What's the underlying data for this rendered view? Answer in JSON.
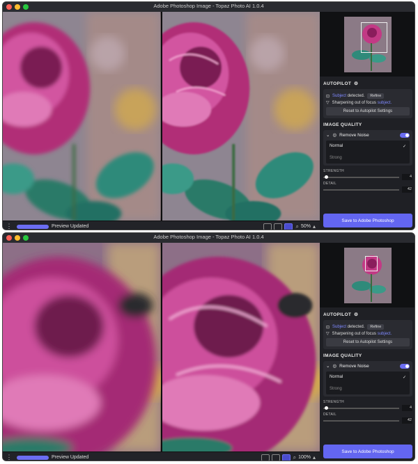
{
  "windows": [
    {
      "title": "Adobe Photoshop Image - Topaz Photo AI 1.0.4",
      "status": "Preview Updated",
      "zoom": "50%",
      "zoom_level": 0.5
    },
    {
      "title": "Adobe Photoshop Image - Topaz Photo AI 1.0.4",
      "status": "Preview Updated",
      "zoom": "100%",
      "zoom_level": 1.0
    }
  ],
  "panel": {
    "autopilot_header": "AUTOPILOT",
    "subject_word": "Subject",
    "subject_detected": "detected.",
    "refine_label": "Refine",
    "sharpening_text": "Sharpening out of focus",
    "sharpening_subject": "subject.",
    "reset_label": "Reset to Autopilot Settings",
    "image_quality_header": "IMAGE QUALITY",
    "remove_noise_label": "Remove Noise",
    "remove_noise_enabled": true,
    "modes": [
      "Normal",
      "Strong"
    ],
    "selected_mode": "Normal",
    "strength_label": "STRENGTH",
    "strength_value": "4",
    "detail_label": "DETAIL",
    "detail_value": "42",
    "save_label": "Save to Adobe Photoshop"
  },
  "icons": {
    "menu": "vertical-dots-icon",
    "gear": "gear-icon",
    "subject": "subject-detect-icon",
    "sharpen": "sharpen-icon",
    "chevron": "chevron-down-icon",
    "noise": "remove-noise-icon",
    "check": "checkmark-icon",
    "zoom": "magnifier-icon"
  },
  "colors": {
    "accent": "#6366f1",
    "link": "#7f89ff",
    "rose": "#c0327e",
    "leaf": "#2f8a7a"
  }
}
